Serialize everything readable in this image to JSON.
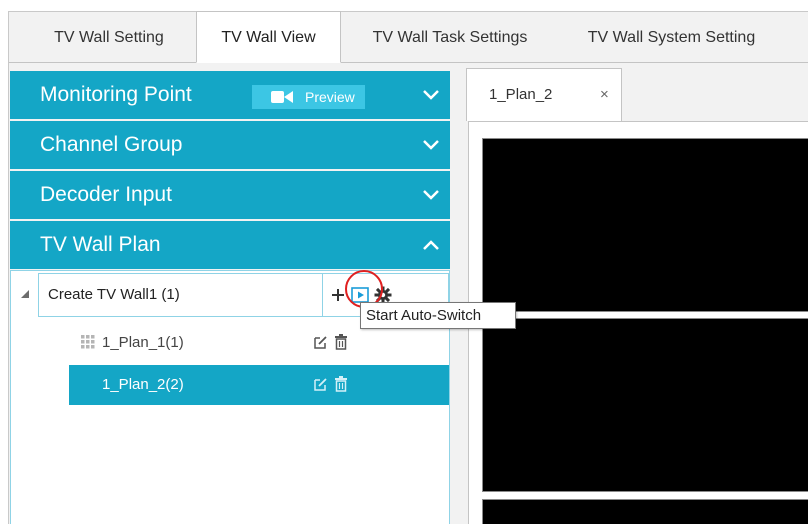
{
  "tabs": [
    {
      "label": "TV Wall Setting",
      "active": false
    },
    {
      "label": "TV Wall View",
      "active": true
    },
    {
      "label": "TV Wall Task Settings",
      "active": false
    },
    {
      "label": "TV Wall System Setting",
      "active": false
    }
  ],
  "accordion": {
    "monitoring_point": {
      "title": "Monitoring Point",
      "preview_label": "Preview",
      "expanded": false
    },
    "channel_group": {
      "title": "Channel Group",
      "expanded": false
    },
    "decoder_input": {
      "title": "Decoder Input",
      "expanded": false
    },
    "tv_wall_plan": {
      "title": "TV Wall Plan",
      "expanded": true
    }
  },
  "tree": {
    "root": {
      "label": "Create TV Wall1 (1)",
      "actions": [
        "add-icon",
        "start-auto-switch-icon",
        "gear-icon"
      ]
    },
    "plans": [
      {
        "label": "1_Plan_1(1)",
        "selected": false,
        "actions": [
          "edit-icon",
          "delete-icon"
        ]
      },
      {
        "label": "1_Plan_2(2)",
        "selected": true,
        "actions": [
          "edit-icon",
          "delete-icon"
        ]
      }
    ]
  },
  "tooltip": {
    "text": "Start Auto-Switch"
  },
  "view": {
    "tab_label": "1_Plan_2",
    "close_glyph": "×",
    "screens": [
      {
        "id": 1
      },
      {
        "id": 2
      },
      {
        "id": 3
      }
    ]
  },
  "colors": {
    "accent": "#14a6c6",
    "preview_button": "#3cc6e4",
    "screen": "#000000",
    "highlight": "#e02020"
  }
}
